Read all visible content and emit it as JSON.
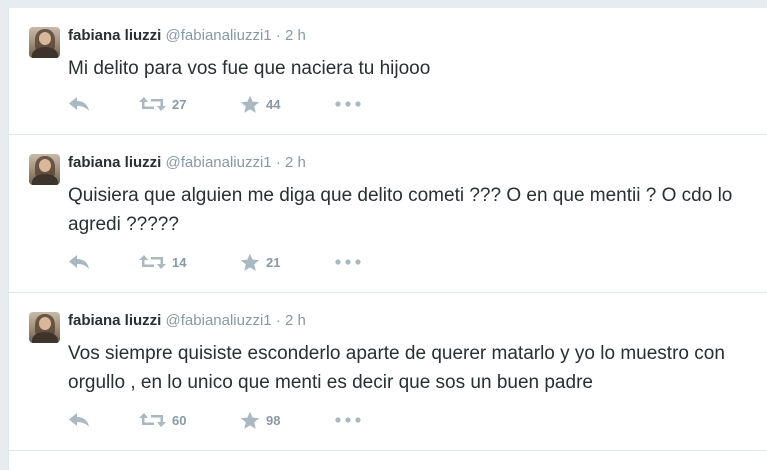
{
  "tweets": [
    {
      "author_name": "fabiana liuzzi",
      "handle": "@fabianaliuzzi1",
      "separator": "·",
      "time": "2 h",
      "text": "Mi delito para vos fue que naciera tu hijooo",
      "retweets": "27",
      "favorites": "44"
    },
    {
      "author_name": "fabiana liuzzi",
      "handle": "@fabianaliuzzi1",
      "separator": "·",
      "time": "2 h",
      "text": "Quisiera que alguien me diga que delito cometi ??? O en que mentii ? O cdo lo agredi ?????",
      "retweets": "14",
      "favorites": "21"
    },
    {
      "author_name": "fabiana liuzzi",
      "handle": "@fabianaliuzzi1",
      "separator": "·",
      "time": "2 h",
      "text": "Vos siempre quisiste esconderlo aparte de querer matarlo y yo lo muestro con orgullo , en lo unico que menti es decir que sos un buen padre",
      "retweets": "60",
      "favorites": "98"
    }
  ],
  "icons": {
    "reply": "reply-icon",
    "retweet": "retweet-icon",
    "favorite": "star-icon",
    "more": "more-icon"
  },
  "colors": {
    "background": "#e6ecf0",
    "text": "#292f33",
    "secondary": "#8899a6",
    "icon": "#aab8c2",
    "border": "#e1e8ed"
  }
}
